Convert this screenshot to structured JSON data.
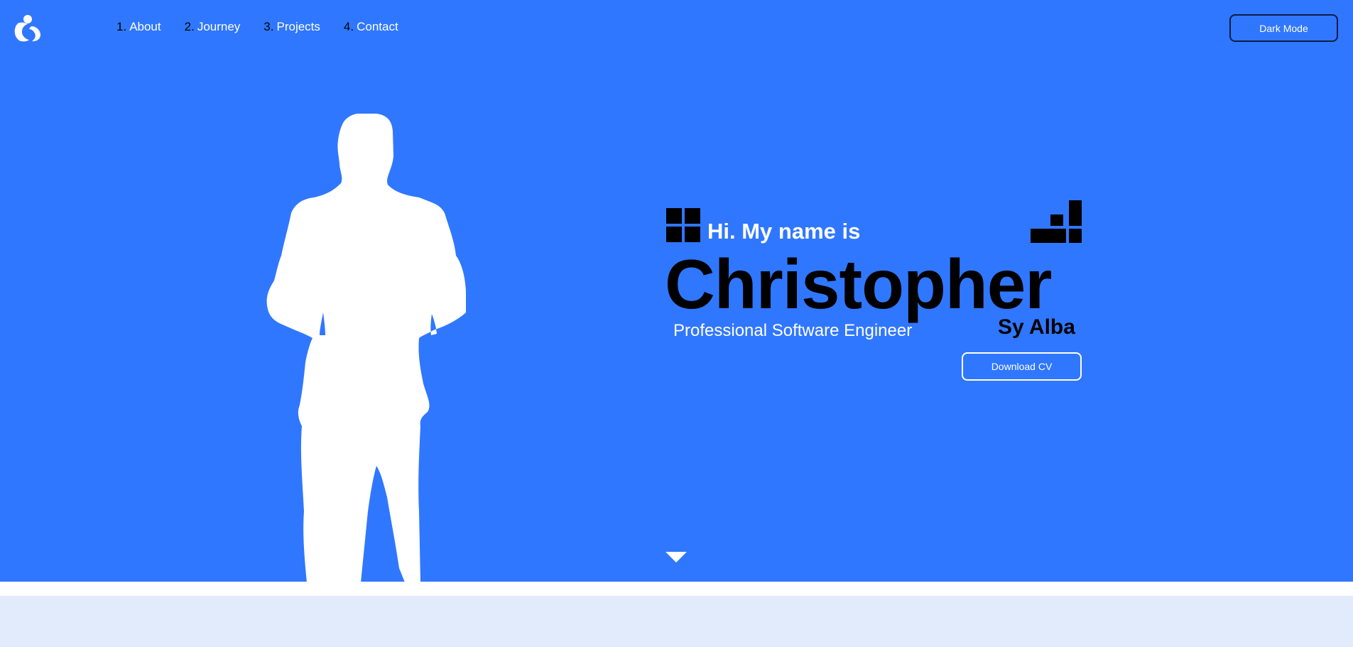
{
  "header": {
    "logo_icon": "stylized-c-logo-icon",
    "nav": [
      {
        "number": "1.",
        "label": "About"
      },
      {
        "number": "2.",
        "label": "Journey"
      },
      {
        "number": "3.",
        "label": "Projects"
      },
      {
        "number": "4.",
        "label": "Contact"
      }
    ],
    "dark_mode_label": "Dark Mode"
  },
  "hero": {
    "greeting": "Hi. My name is",
    "first_name": "Christopher",
    "last_name": "Sy Alba",
    "role": "Professional Software Engineer",
    "download_cv_label": "Download CV",
    "silhouette_icon": "person-silhouette-icon",
    "scroll_icon": "down-arrow-icon"
  },
  "colors": {
    "hero_background": "#3077ff",
    "text_primary": "#ffffff",
    "text_dark": "#000000",
    "lower_section": "#e2ebfb"
  }
}
